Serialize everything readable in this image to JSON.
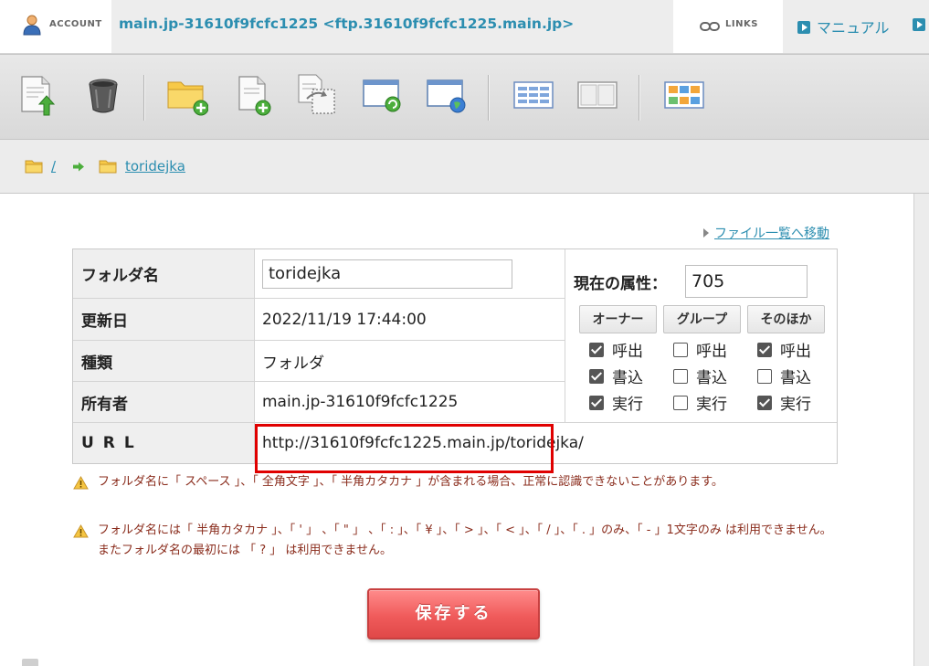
{
  "header": {
    "account_label": "ACCOUNT",
    "account_name": "main.jp-31610f9fcfc1225 <ftp.31610f9fcfc1225.main.jp>",
    "links_label": "LINKS",
    "manual_label": "マニュアル"
  },
  "toolbar": {
    "icons": [
      "upload-file-icon",
      "trash-icon",
      "new-folder-icon",
      "new-file-icon",
      "copy-file-icon",
      "window-refresh-icon",
      "window-globe-icon",
      "list-view-icon",
      "detail-view-icon",
      "thumbnail-view-icon"
    ]
  },
  "breadcrumb": {
    "root": "/",
    "current": "toridejka"
  },
  "file_list_link": "ファイル一覧へ移動",
  "details": {
    "folder_name_label": "フォルダ名",
    "folder_name_value": "toridejka",
    "updated_label": "更新日",
    "updated_value": "2022/11/19 17:44:00",
    "type_label": "種類",
    "type_value": "フォルダ",
    "owner_label": "所有者",
    "owner_value": "main.jp-31610f9fcfc1225",
    "url_label": "URL",
    "url_value": "http://31610f9fcfc1225.main.jp/toridejka/"
  },
  "attributes": {
    "label": "現在の属性：",
    "value": "705",
    "groups": [
      {
        "name": "オーナー",
        "read": true,
        "write": true,
        "exec": true
      },
      {
        "name": "グループ",
        "read": false,
        "write": false,
        "exec": false
      },
      {
        "name": "そのほか",
        "read": true,
        "write": false,
        "exec": true
      }
    ],
    "perm_labels": {
      "read": "呼出",
      "write": "書込",
      "exec": "実行"
    }
  },
  "warnings": [
    "フォルダ名に「 スペース 」、「 全角文字 」、「 半角カタカナ 」が含まれる場合、正常に認識できないことがあります。",
    "フォルダ名には「 半角カタカナ 」、「 ' 」 、「 \" 」 、「 : 」、「 ¥ 」、「 > 」、「 < 」、「 / 」、「 . 」のみ、「 - 」1文字のみ は利用できません。またフォルダ名の最初には 「 ? 」 は利用できません。"
  ],
  "save_label": "保存する",
  "colors": {
    "accent": "#2c8eb0",
    "save_button": "#f05b5b",
    "highlight": "#e00000",
    "warning_text": "#8a2c1c"
  }
}
